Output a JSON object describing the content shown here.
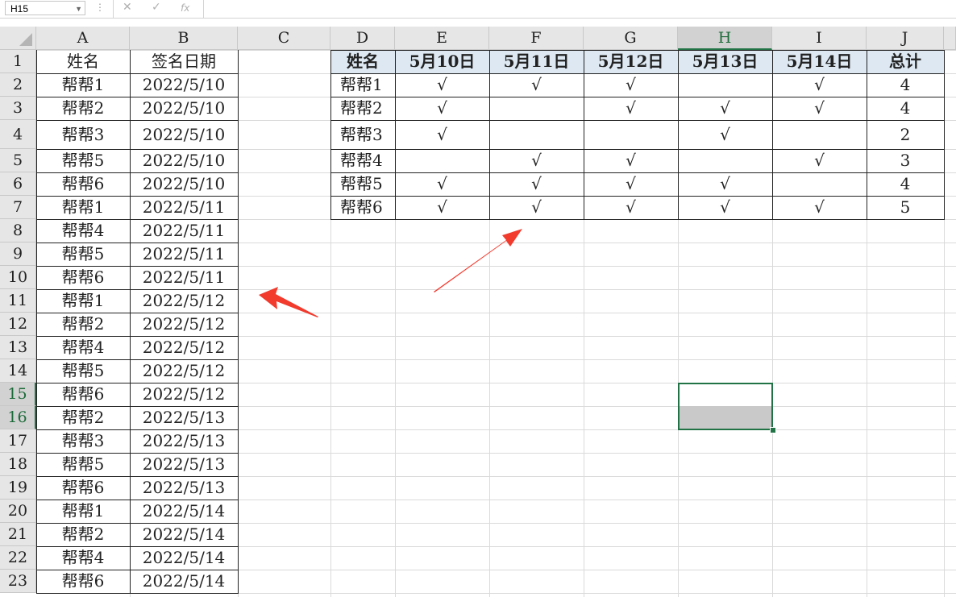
{
  "formula_bar": {
    "name_box": "H15",
    "cancel_icon": "✕",
    "enter_icon": "✓",
    "fx_label": "fx",
    "formula": ""
  },
  "columns": [
    "A",
    "B",
    "C",
    "D",
    "E",
    "F",
    "G",
    "H",
    "I",
    "J"
  ],
  "rows": [
    "1",
    "2",
    "3",
    "4",
    "5",
    "6",
    "7",
    "8",
    "9",
    "10",
    "11",
    "12",
    "13",
    "14",
    "15",
    "16",
    "17",
    "18",
    "19",
    "20",
    "21",
    "22",
    "23"
  ],
  "selected_cell": "H15",
  "left_table": {
    "headers": [
      "姓名",
      "签名日期"
    ],
    "rows": [
      [
        "帮帮1",
        "2022/5/10"
      ],
      [
        "帮帮2",
        "2022/5/10"
      ],
      [
        "帮帮3",
        "2022/5/10"
      ],
      [
        "帮帮5",
        "2022/5/10"
      ],
      [
        "帮帮6",
        "2022/5/10"
      ],
      [
        "帮帮1",
        "2022/5/11"
      ],
      [
        "帮帮4",
        "2022/5/11"
      ],
      [
        "帮帮5",
        "2022/5/11"
      ],
      [
        "帮帮6",
        "2022/5/11"
      ],
      [
        "帮帮1",
        "2022/5/12"
      ],
      [
        "帮帮2",
        "2022/5/12"
      ],
      [
        "帮帮4",
        "2022/5/12"
      ],
      [
        "帮帮5",
        "2022/5/12"
      ],
      [
        "帮帮6",
        "2022/5/12"
      ],
      [
        "帮帮2",
        "2022/5/13"
      ],
      [
        "帮帮3",
        "2022/5/13"
      ],
      [
        "帮帮5",
        "2022/5/13"
      ],
      [
        "帮帮6",
        "2022/5/13"
      ],
      [
        "帮帮1",
        "2022/5/14"
      ],
      [
        "帮帮2",
        "2022/5/14"
      ],
      [
        "帮帮4",
        "2022/5/14"
      ],
      [
        "帮帮6",
        "2022/5/14"
      ]
    ]
  },
  "right_table": {
    "headers": [
      "姓名",
      "5月10日",
      "5月11日",
      "5月12日",
      "5月13日",
      "5月14日",
      "总计"
    ],
    "rows": [
      [
        "帮帮1",
        "√",
        "√",
        "√",
        "",
        "√",
        "4"
      ],
      [
        "帮帮2",
        "√",
        "",
        "√",
        "√",
        "√",
        "4"
      ],
      [
        "帮帮3",
        "√",
        "",
        "",
        "√",
        "",
        "2"
      ],
      [
        "帮帮4",
        "",
        "√",
        "√",
        "",
        "√",
        "3"
      ],
      [
        "帮帮5",
        "√",
        "√",
        "√",
        "√",
        "",
        "4"
      ],
      [
        "帮帮6",
        "√",
        "√",
        "√",
        "√",
        "√",
        "5"
      ]
    ]
  },
  "colors": {
    "header_fill": "#dde8f2",
    "selection": "#217346",
    "arrow": "#f23a2d"
  }
}
